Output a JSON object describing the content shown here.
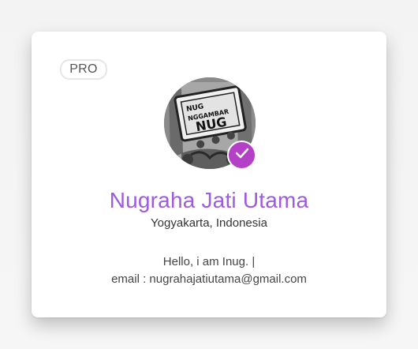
{
  "profile": {
    "badge": "PRO",
    "avatar_text": {
      "line1": "NUG",
      "line2": "NGGAMBAR",
      "line3": "NUG"
    },
    "verified_icon": "check-icon",
    "name": "Nugraha Jati Utama",
    "location": "Yogyakarta, Indonesia",
    "bio_line1": "Hello, i am Inug. |",
    "bio_line2": "email : nugrahajatiutama@gmail.com"
  },
  "colors": {
    "name": "#9d5be0",
    "verified": "#b340c6",
    "card": "#ffffff"
  }
}
